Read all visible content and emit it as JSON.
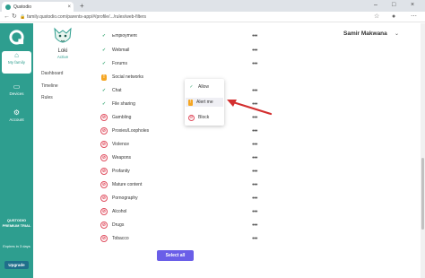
{
  "browser": {
    "tab_title": "Qustodio",
    "tab_close": "×",
    "new_tab": "+",
    "url": "family.qustodio.com/parents-app/#/profile/.../rules/web-filters",
    "minimize": "–",
    "maximize": "□",
    "close": "×"
  },
  "sidebar": {
    "items": [
      {
        "label": "My family",
        "icon": "home-icon",
        "glyph": "⌂"
      },
      {
        "label": "Devices",
        "icon": "devices-icon",
        "glyph": "▭"
      },
      {
        "label": "Account",
        "icon": "gear-icon",
        "glyph": "⚙"
      }
    ],
    "promo": "QUSTODIO PREMIUM TRIAL",
    "expires": "Expires in 3 days",
    "upgrade": "Upgrade"
  },
  "child": {
    "name": "Loki",
    "status": "Active",
    "menu": [
      "Dashboard",
      "Timeline",
      "Rules"
    ]
  },
  "header": {
    "user": "Samir Makwana",
    "chevron": "⌄"
  },
  "categories": [
    {
      "label": "Employment",
      "state": "allow"
    },
    {
      "label": "Webmail",
      "state": "allow"
    },
    {
      "label": "Forums",
      "state": "allow"
    },
    {
      "label": "Social networks",
      "state": "alert"
    },
    {
      "label": "Chat",
      "state": "allow"
    },
    {
      "label": "File sharing",
      "state": "allow"
    },
    {
      "label": "Gambling",
      "state": "block"
    },
    {
      "label": "Proxies/Loopholes",
      "state": "block"
    },
    {
      "label": "Violence",
      "state": "block"
    },
    {
      "label": "Weapons",
      "state": "block"
    },
    {
      "label": "Profanity",
      "state": "block"
    },
    {
      "label": "Mature content",
      "state": "block"
    },
    {
      "label": "Pornography",
      "state": "block"
    },
    {
      "label": "Alcohol",
      "state": "block"
    },
    {
      "label": "Drugs",
      "state": "block"
    },
    {
      "label": "Tobacco",
      "state": "block"
    }
  ],
  "glyphs": {
    "allow": "✓",
    "alert": "!",
    "block": "⊘",
    "dots": "•••"
  },
  "dropdown": {
    "allow": "Allow",
    "alert": "Alert me",
    "block": "Block"
  },
  "select_all": "Select all",
  "colors": {
    "brand": "#2e9e8f",
    "accent": "#6a5ee8",
    "block": "#e04e5f",
    "alert": "#f5a623",
    "allow": "#3aa874",
    "arrow": "#d32f2f"
  }
}
